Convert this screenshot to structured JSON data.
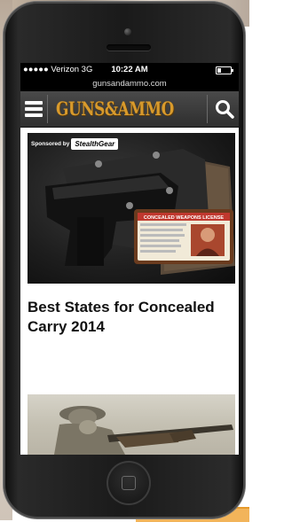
{
  "status_bar": {
    "carrier": "●●●●● Verizon  3G",
    "time": "10:22 AM"
  },
  "browser": {
    "url": "gunsandammo.com"
  },
  "app_header": {
    "logo_text": "GUNS&AMMO",
    "menu_icon": "hamburger-menu-icon",
    "search_icon": "search-icon"
  },
  "article": {
    "sponsored_label": "Sponsored by",
    "sponsor_name": "StealthGear",
    "license_card_title": "CONCEALED WEAPONS LICENSE",
    "headline": "Best States for Concealed Carry 2014"
  },
  "colors": {
    "logo": "#d89a2c",
    "header_bg": "#3a3a3a"
  }
}
